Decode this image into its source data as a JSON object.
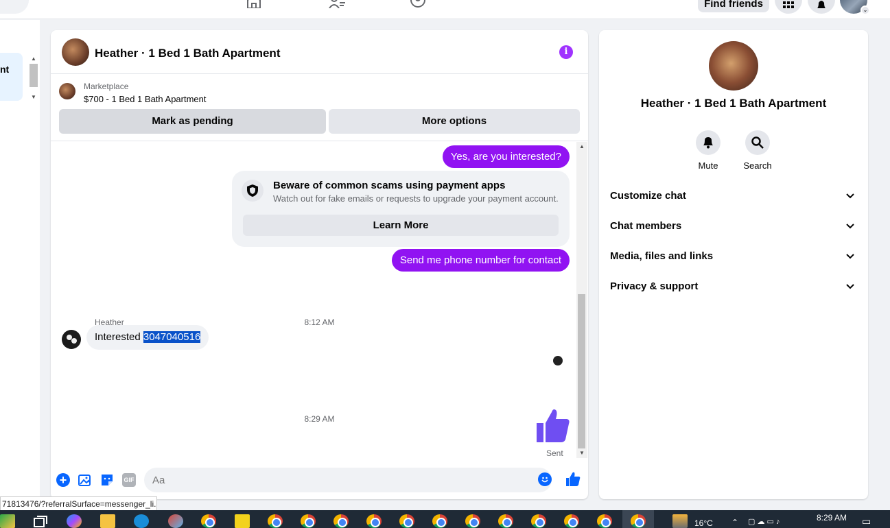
{
  "nav": {
    "find_friends": "Find friends"
  },
  "left": {
    "item_fragment": "nt"
  },
  "chat": {
    "title": "Heather · 1 Bed 1 Bath Apartment",
    "listing": {
      "label": "Marketplace",
      "price_title": "$700 - 1 Bed 1 Bath Apartment",
      "mark_pending": "Mark as pending",
      "more_options": "More options"
    },
    "messages": {
      "out1": "Yes, are you interested?",
      "warning_title": "Beware of common scams using payment apps",
      "warning_sub": "Watch out for fake emails or requests to upgrade your payment account.",
      "learn_more": "Learn More",
      "out2": "Send me phone number for contact",
      "time1": "8:12 AM",
      "sender": "Heather",
      "in_prefix": "Interested ",
      "in_phone": "3047040516",
      "time2": "8:29 AM",
      "sent": "Sent"
    },
    "composer": {
      "placeholder": "Aa",
      "gif": "GIF"
    }
  },
  "details": {
    "title": "Heather · 1 Bed 1 Bath Apartment",
    "mute": "Mute",
    "search": "Search",
    "sections": [
      "Customize chat",
      "Chat members",
      "Media, files and links",
      "Privacy & support"
    ]
  },
  "status_url": "71813476/?referralSurface=messenger_li...",
  "taskbar": {
    "temp": "16°C",
    "time": "8:29 AM"
  },
  "colors": {
    "accent": "#9113f2",
    "brand": "#0866ff",
    "like": "#6f4ef2"
  }
}
